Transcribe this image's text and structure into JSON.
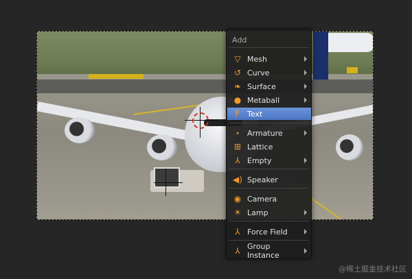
{
  "menu": {
    "title": "Add",
    "items": [
      {
        "label": "Mesh",
        "icon": "mesh-icon",
        "glyph": "▽",
        "submenu": true
      },
      {
        "label": "Curve",
        "icon": "curve-icon",
        "glyph": "↺",
        "submenu": true
      },
      {
        "label": "Surface",
        "icon": "surface-icon",
        "glyph": "❧",
        "submenu": true
      },
      {
        "label": "Metaball",
        "icon": "metaball-icon",
        "glyph": "●",
        "submenu": true
      },
      {
        "label": "Text",
        "icon": "text-icon",
        "glyph": "F",
        "submenu": false,
        "active": true
      },
      {
        "label": "Armature",
        "icon": "armature-icon",
        "glyph": "⋆",
        "submenu": true
      },
      {
        "label": "Lattice",
        "icon": "lattice-icon",
        "glyph": "⊞",
        "submenu": false
      },
      {
        "label": "Empty",
        "icon": "empty-icon",
        "glyph": "⅄",
        "submenu": true
      },
      {
        "label": "Speaker",
        "icon": "speaker-icon",
        "glyph": "◀)",
        "submenu": false
      },
      {
        "label": "Camera",
        "icon": "camera-icon",
        "glyph": "◉",
        "submenu": false
      },
      {
        "label": "Lamp",
        "icon": "lamp-icon",
        "glyph": "☀",
        "submenu": true
      },
      {
        "label": "Force Field",
        "icon": "force-field-icon",
        "glyph": "⅄",
        "submenu": true
      },
      {
        "label": "Group Instance",
        "icon": "group-instance-icon",
        "glyph": "⅄",
        "submenu": true
      }
    ]
  },
  "watermark": "@稀土掘金技术社区",
  "colors": {
    "active_highlight": "#5a83d0",
    "icon_orange": "#ef9a2b",
    "menu_bg": "#1e1e1e"
  }
}
